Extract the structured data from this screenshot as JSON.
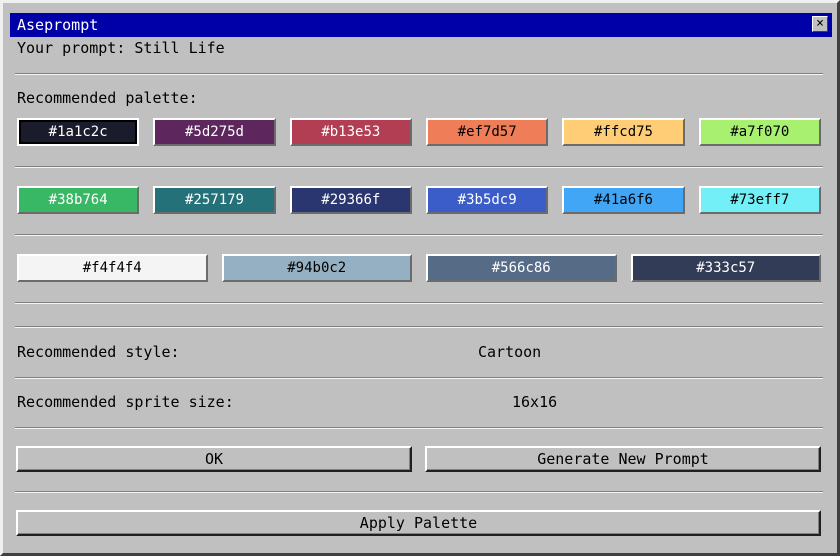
{
  "window": {
    "title": "Aseprompt",
    "close_glyph": "×"
  },
  "prompt": {
    "text": "Your prompt: Still Life"
  },
  "palette": {
    "label": "Recommended palette:",
    "rows": [
      [
        {
          "hex": "#1a1c2c",
          "selected": true
        },
        {
          "hex": "#5d275d"
        },
        {
          "hex": "#b13e53"
        },
        {
          "hex": "#ef7d57"
        },
        {
          "hex": "#ffcd75"
        },
        {
          "hex": "#a7f070"
        }
      ],
      [
        {
          "hex": "#38b764"
        },
        {
          "hex": "#257179"
        },
        {
          "hex": "#29366f"
        },
        {
          "hex": "#3b5dc9"
        },
        {
          "hex": "#41a6f6"
        },
        {
          "hex": "#73eff7"
        }
      ],
      [
        {
          "hex": "#f4f4f4"
        },
        {
          "hex": "#94b0c2"
        },
        {
          "hex": "#566c86"
        },
        {
          "hex": "#333c57"
        }
      ]
    ]
  },
  "style": {
    "label": "Recommended style:",
    "value": "Cartoon"
  },
  "sprite_size": {
    "label": "Recommended sprite size:",
    "value": "16x16"
  },
  "buttons": {
    "ok": "OK",
    "generate": "Generate New Prompt",
    "apply": "Apply Palette"
  }
}
